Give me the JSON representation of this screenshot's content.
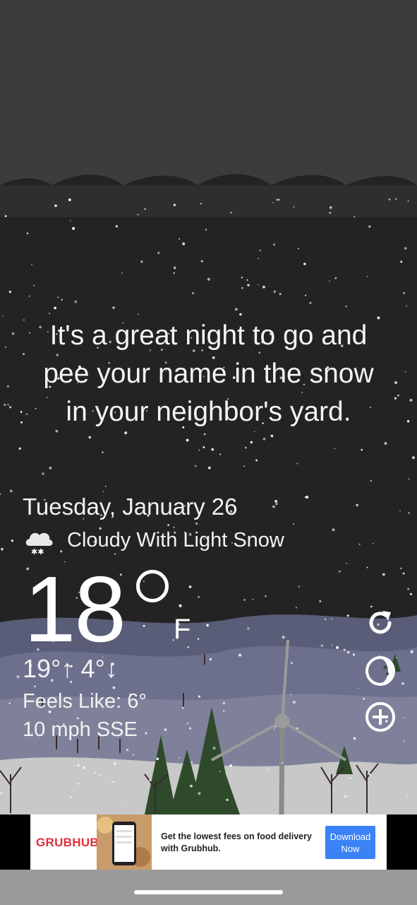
{
  "message": {
    "line1": "It's a great night to go and",
    "line2": "pee your name in the snow",
    "line3": "in your neighbor's yard."
  },
  "weather": {
    "date": "Tuesday, January 26",
    "condition_icon": "cloud-snow-icon",
    "condition": "Cloudy With Light Snow",
    "temperature": "18",
    "unit": "F",
    "high_low": "19°↑ 4°↓",
    "feels_like": "Feels Like: 6°",
    "wind": "10 mph SSE"
  },
  "side_buttons": [
    "refresh-icon",
    "moon-phase-icon",
    "add-location-icon"
  ],
  "ad": {
    "brand": "GRUBHUB",
    "text": "Get the lowest fees on food delivery with Grubhub.",
    "cta": "Download Now"
  },
  "colors": {
    "sky_top": "#3a3a3a",
    "sky_night": "#222222",
    "hills": "#7c7f9a",
    "snow_ground": "#c9c9c9",
    "trees": "#2f4a2a",
    "ad_cta": "#3b82f6",
    "ad_brand": "#e0303a"
  }
}
